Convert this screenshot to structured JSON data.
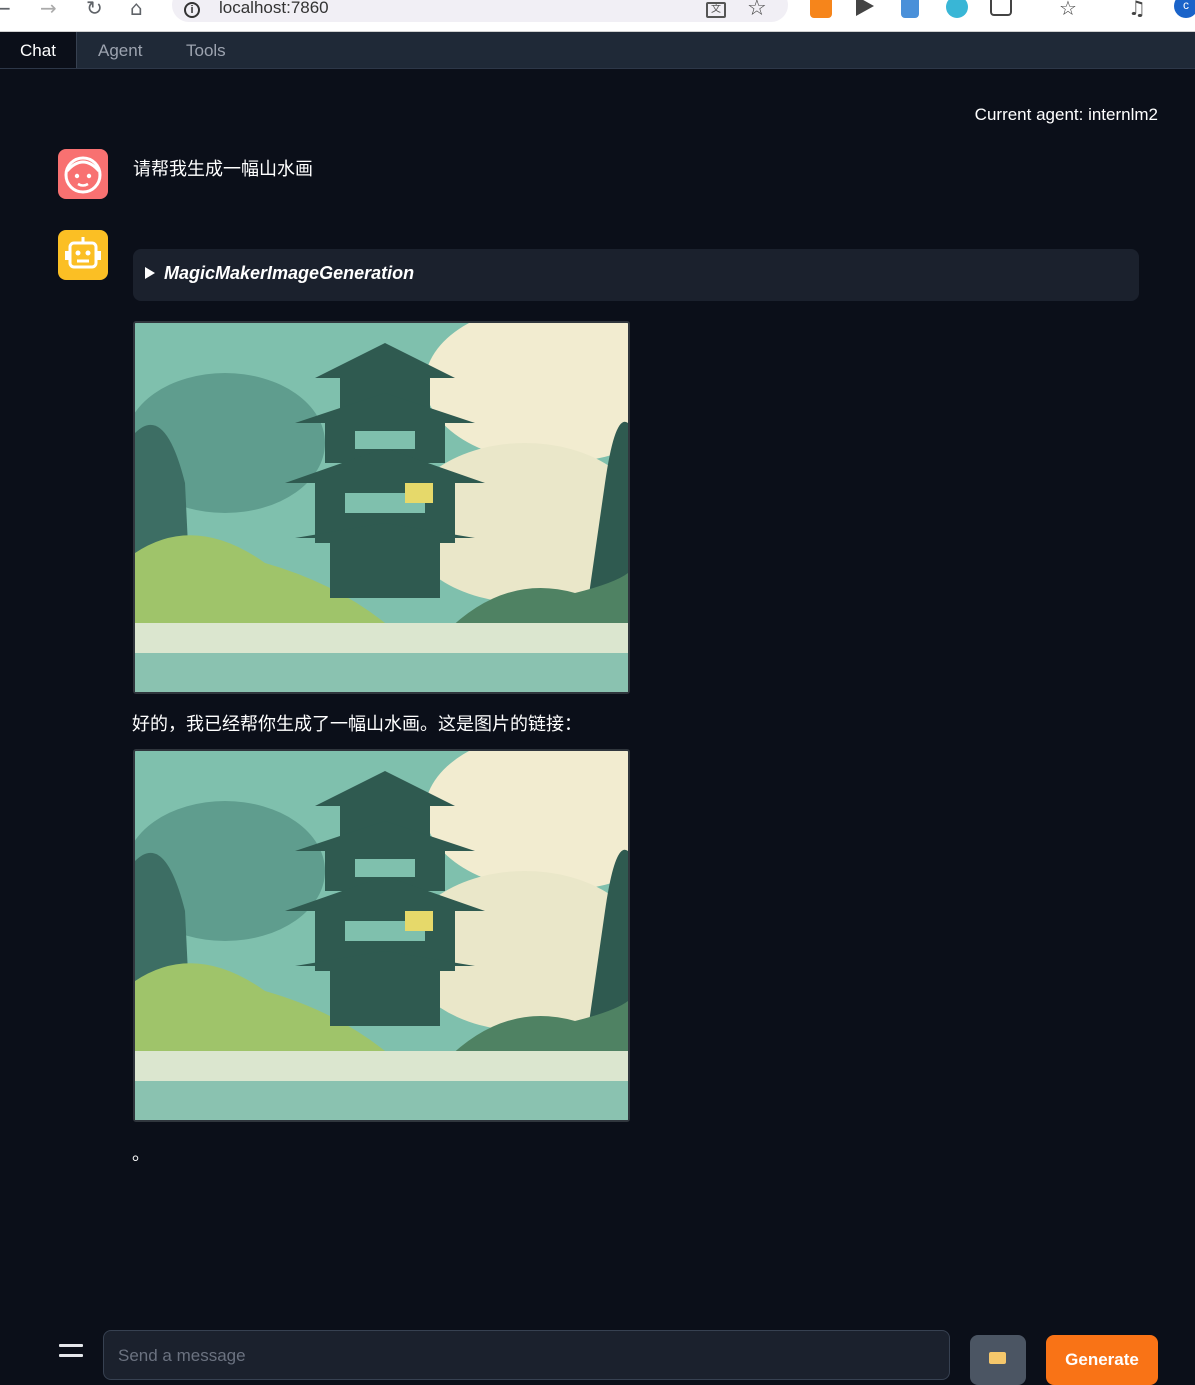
{
  "browser": {
    "url": "localhost:7860",
    "profile_initial": "c",
    "extension_icons": [
      "metamask-icon",
      "media-icon",
      "doc-icon",
      "color-icon",
      "puzzle-icon",
      "favorites-icon",
      "media-control-icon"
    ]
  },
  "tabs": [
    {
      "label": "Chat",
      "active": true
    },
    {
      "label": "Agent",
      "active": false
    },
    {
      "label": "Tools",
      "active": false
    }
  ],
  "agent_status": "Current agent: internlm2",
  "messages": [
    {
      "role": "user",
      "avatar": "user-face-icon",
      "text": "请帮我生成一幅山水画"
    },
    {
      "role": "assistant",
      "avatar": "robot-icon",
      "tool_call": "MagicMakerImageGeneration",
      "text": "好的，我已经帮你生成了一幅山水画。这是图片的链接：",
      "trailing_text": "。"
    }
  ],
  "input": {
    "placeholder": "Send a message",
    "value": ""
  },
  "buttons": {
    "generate": "Generate"
  },
  "colors": {
    "accent": "#f97316",
    "background": "#0b0f19",
    "user_avatar": "#f87171",
    "bot_avatar": "#fbbf24"
  }
}
